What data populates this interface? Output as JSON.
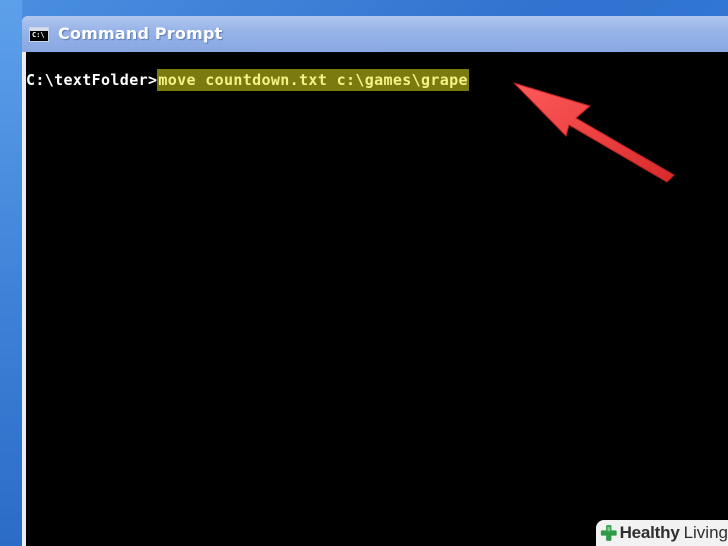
{
  "window": {
    "title": "Command Prompt",
    "icon": "cmd-window-icon",
    "icon_glyph": "C:\\"
  },
  "console": {
    "prompt": "C:\\textFolder>",
    "command": "move countdown.txt c:\\games\\grape",
    "colors": {
      "background": "#000000",
      "text": "#ffffff",
      "highlight_bg": "#7a7a10",
      "highlight_text": "#f3f384"
    }
  },
  "annotation": {
    "icon": "red-arrow-icon",
    "color": "#ee3b3b"
  },
  "watermark": {
    "brand_bold": "Healthy",
    "brand_regular": "Living",
    "icon": "green-cross-icon"
  }
}
